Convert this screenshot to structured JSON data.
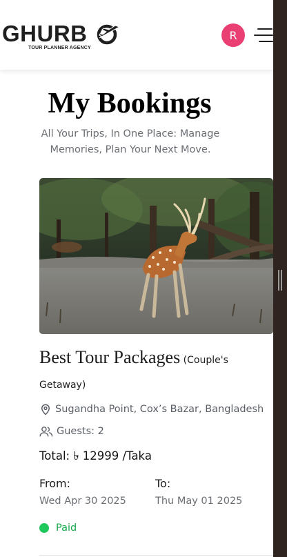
{
  "brand": {
    "name": "GHURB",
    "tagline": "TOUR PLANNER AGENCY"
  },
  "header": {
    "avatar_initial": "R",
    "icons": [
      "plane-globe-logo-icon",
      "hamburger-menu-icon"
    ]
  },
  "page": {
    "title": "My Bookings",
    "subtitle": "All Your Trips, In One Place: Manage Memories, Plan Your Next Move."
  },
  "booking": {
    "image_subject": "spotted deer in forest clearing",
    "package_name": "Best Tour Packages",
    "package_type": "(Couple's Getaway)",
    "location": "Sugandha Point, Cox’s Bazar, Bangladesh",
    "guests": "Guests: 2",
    "total": "Total: ৳ 12999 /Taka",
    "from_label": "From:",
    "from_date": "Wed Apr 30 2025",
    "to_label": "To:",
    "to_date": "Thu May 01 2025",
    "status": "Paid"
  },
  "colors": {
    "avatar": "#ea3f72",
    "status_paid": "#1ec85a",
    "status_text": "#17a84b",
    "muted_text": "#6b6f74",
    "side_rail": "#2f2420"
  }
}
